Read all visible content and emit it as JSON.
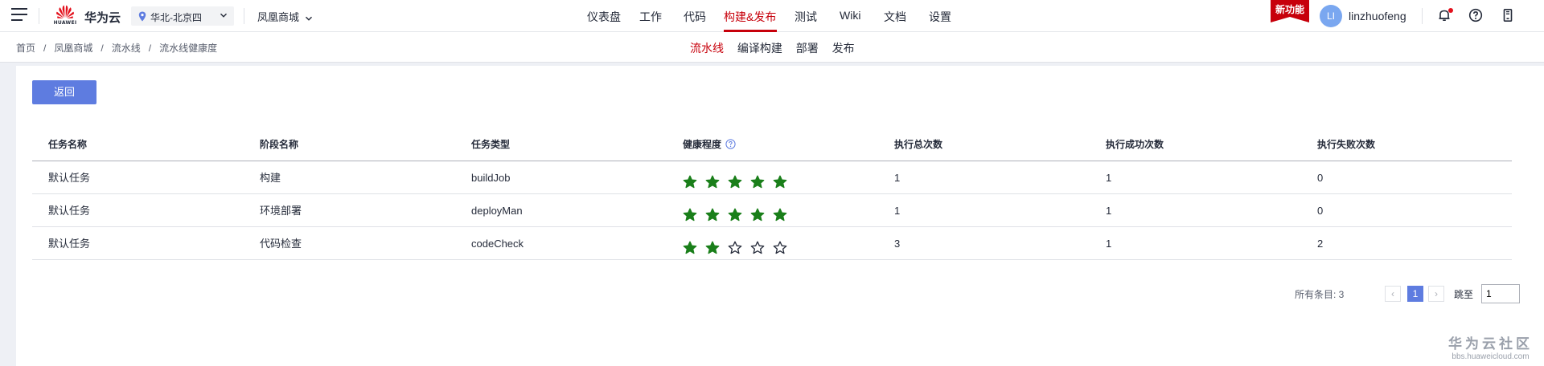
{
  "header": {
    "brand": "华为云",
    "logo_word": "HUAWEI",
    "region": "华北-北京四",
    "project": "凤凰商城",
    "nav": [
      {
        "label": "仪表盘"
      },
      {
        "label": "工作"
      },
      {
        "label": "代码"
      },
      {
        "label": "构建&发布"
      },
      {
        "label": "测试"
      },
      {
        "label": "Wiki"
      },
      {
        "label": "文档"
      },
      {
        "label": "设置"
      }
    ],
    "active_nav": "构建&发布",
    "new_feature": "新功能",
    "avatar_initials": "LI",
    "username": "linzhuofeng",
    "accent": "#c7000b"
  },
  "breadcrumb": [
    "首页",
    "凤凰商城",
    "流水线",
    "流水线健康度"
  ],
  "subtabs": [
    {
      "label": "流水线"
    },
    {
      "label": "编译构建"
    },
    {
      "label": "部署"
    },
    {
      "label": "发布"
    }
  ],
  "active_subtab": "流水线",
  "back_button": "返回",
  "table": {
    "columns": [
      "任务名称",
      "阶段名称",
      "任务类型",
      "健康程度",
      "执行总次数",
      "执行成功次数",
      "执行失败次数"
    ],
    "rows": [
      {
        "task": "默认任务",
        "stage": "构建",
        "type": "buildJob",
        "health": 5,
        "total": "1",
        "success": "1",
        "fail": "0"
      },
      {
        "task": "默认任务",
        "stage": "环境部署",
        "type": "deployMan",
        "health": 5,
        "total": "1",
        "success": "1",
        "fail": "0"
      },
      {
        "task": "默认任务",
        "stage": "代码检查",
        "type": "codeCheck",
        "health": 2,
        "total": "3",
        "success": "1",
        "fail": "2"
      }
    ]
  },
  "pagination": {
    "total_label": "所有条目: 3",
    "current_page": "1",
    "jump_label": "跳至",
    "jump_value": "1"
  },
  "watermark": {
    "line1": "华为云社区",
    "line2": "bbs.huaweicloud.com"
  }
}
